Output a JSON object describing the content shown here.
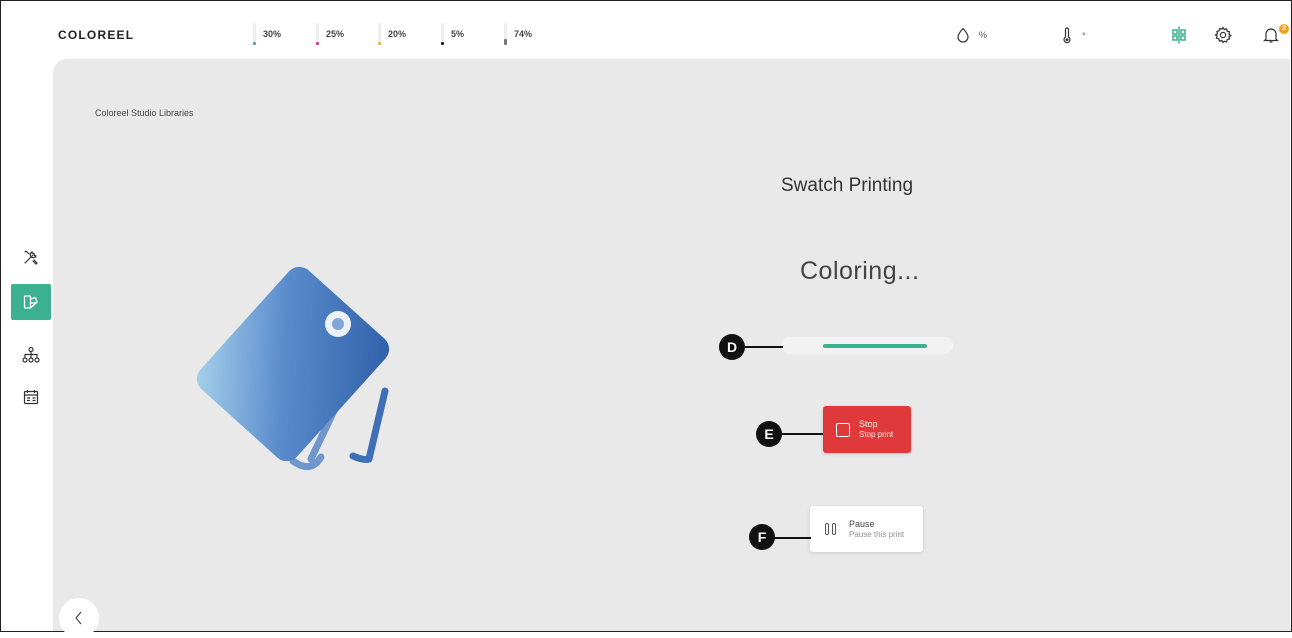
{
  "app": {
    "logo_text": "COLOREEL"
  },
  "ink_levels": [
    {
      "label": "30%",
      "fill_fraction": 0.3,
      "color": "#29b6c9"
    },
    {
      "label": "25%",
      "fill_fraction": 0.25,
      "color": "#d63b8f"
    },
    {
      "label": "20%",
      "fill_fraction": 0.2,
      "color": "#f0b43a"
    },
    {
      "label": "5%",
      "fill_fraction": 0.05,
      "color": "#222222"
    },
    {
      "label": "74%",
      "fill_fraction": 0.74,
      "color": "#777777"
    }
  ],
  "status_bar": {
    "humidity_unit": "%",
    "temperature_unit": "°",
    "notification_count": "3"
  },
  "header_icons": [
    "drop-icon",
    "thermometer-icon",
    "machine-status-icon",
    "gear-icon",
    "bell-icon"
  ],
  "sidebar": {
    "items": [
      {
        "icon": "tools-icon",
        "active": false
      },
      {
        "icon": "swatch-library-icon",
        "active": true
      },
      {
        "icon": "hierarchy-icon",
        "active": false
      },
      {
        "icon": "production-icon",
        "active": false
      }
    ]
  },
  "main": {
    "breadcrumb": "Coloreel Studio Libraries",
    "title": "Swatch Printing",
    "status_text": "Coloring...",
    "progress_fraction": 0.61,
    "stop": {
      "label": "Stop",
      "sublabel": "Stop print"
    },
    "pause": {
      "label": "Pause",
      "sublabel": "Pause this print"
    }
  },
  "callouts": {
    "progress": "D",
    "stop": "E",
    "pause": "F"
  },
  "colors": {
    "accent": "#3bb18f",
    "stop": "#e0393b",
    "badge": "#f3a21b",
    "panel_bg": "#e9e9e9"
  }
}
